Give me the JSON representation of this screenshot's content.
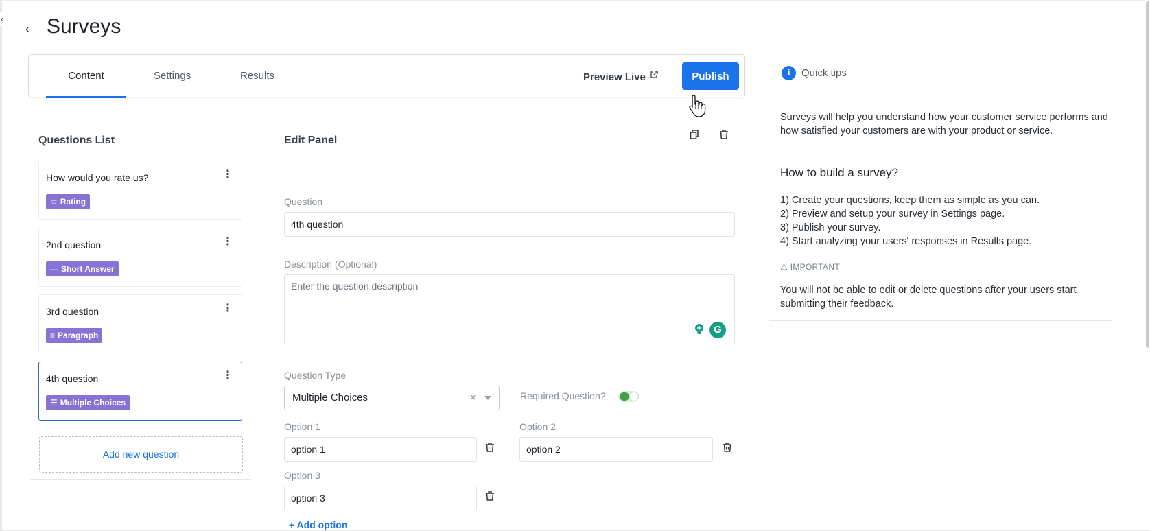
{
  "header": {
    "title": "Surveys",
    "back_icon": "chevron-left-icon"
  },
  "tabs": [
    {
      "label": "Content",
      "active": true
    },
    {
      "label": "Settings",
      "active": false
    },
    {
      "label": "Results",
      "active": false
    }
  ],
  "toolbar": {
    "preview_label": "Preview Live",
    "publish_label": "Publish",
    "accent_color": "#1a73e8"
  },
  "questions_list": {
    "title": "Questions List",
    "items": [
      {
        "title": "How would you rate us?",
        "type": "Rating",
        "type_icon": "star-icon",
        "selected": false
      },
      {
        "title": "2nd question",
        "type": "Short Answer",
        "type_icon": "dash-icon",
        "selected": false
      },
      {
        "title": "3rd question",
        "type": "Paragraph",
        "type_icon": "paragraph-icon",
        "selected": false
      },
      {
        "title": "4th question",
        "type": "Multiple Choices",
        "type_icon": "list-icon",
        "selected": true
      }
    ],
    "badge_color": "#8673d4",
    "add_label": "Add new question"
  },
  "edit_panel": {
    "title": "Edit Panel",
    "question_label": "Question",
    "question_value": "4th question",
    "description_label": "Description (Optional)",
    "description_placeholder": "Enter the question description",
    "type_label": "Question Type",
    "type_value": "Multiple Choices",
    "clear_glyph": "×",
    "required_label": "Required Question?",
    "required_on": true,
    "options": [
      {
        "label": "Option 1",
        "value": "option 1"
      },
      {
        "label": "Option 2",
        "value": "option 2"
      },
      {
        "label": "Option 3",
        "value": "option 3"
      }
    ],
    "add_option_label": "+ Add option"
  },
  "quick_tips": {
    "title": "Quick tips",
    "intro": "Surveys will help you understand how your customer service performs and how satisfied your customers are with your product or service.",
    "heading": "How to build a survey?",
    "steps": [
      "1) Create your questions, keep them as simple as you can.",
      "2) Preview and setup your survey in Settings page.",
      "3) Publish your survey.",
      "4) Start analyzing your users' responses in Results page."
    ],
    "important_label": "⚠ IMPORTANT",
    "important_text": "You will not be able to edit or delete questions after your users start submitting their feedback."
  }
}
